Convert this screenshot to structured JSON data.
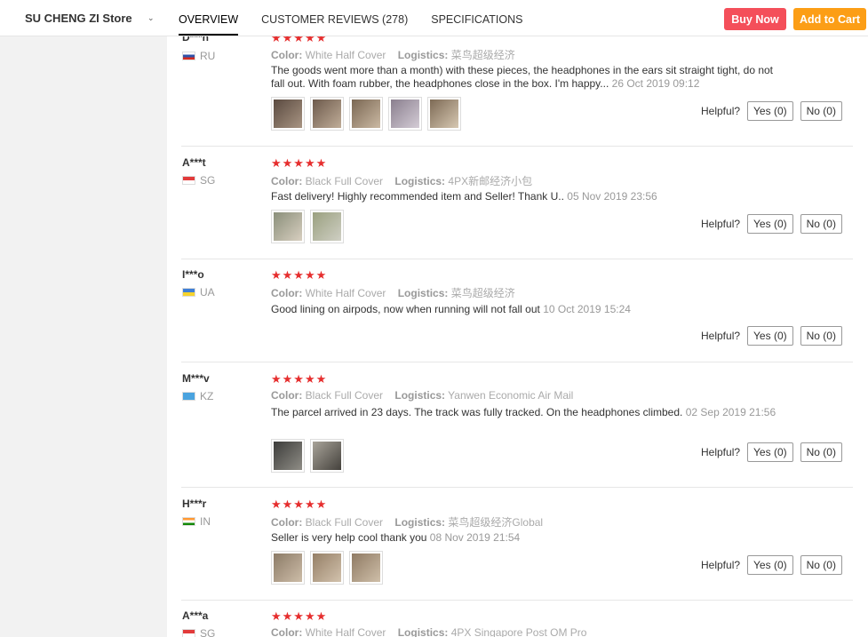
{
  "store": {
    "name": "SU CHENG ZI Store",
    "caret": "⌄"
  },
  "tabs": [
    {
      "label": "OVERVIEW"
    },
    {
      "label": "CUSTOMER REVIEWS (278)"
    },
    {
      "label": "SPECIFICATIONS"
    }
  ],
  "actions": {
    "buy_now": "Buy Now",
    "add_to_cart": "Add to Cart"
  },
  "labels": {
    "color": "Color:",
    "logistics": "Logistics:",
    "helpful": "Helpful?",
    "stars": "★★★★★"
  },
  "reviews": [
    {
      "user": "D***n",
      "country": "RU",
      "color": "White Half Cover",
      "logistics": "菜鸟超级经济",
      "text": "The goods went more than a month) with these pieces, the headphones in the ears sit straight tight, do not fall out. With foam rubber, the headphones close in the box. I'm happy...",
      "date": "26 Oct 2019 09:12",
      "yes": "Yes (0)",
      "no": "No (0)"
    },
    {
      "user": "A***t",
      "country": "SG",
      "color": "Black Full Cover",
      "logistics": "4PX新邮经济小包",
      "text": "Fast delivery! Highly recommended item and Seller! Thank U..",
      "date": "05 Nov 2019 23:56",
      "yes": "Yes (0)",
      "no": "No (0)"
    },
    {
      "user": "I***o",
      "country": "UA",
      "color": "White Half Cover",
      "logistics": "菜鸟超级经济",
      "text": "Good lining on airpods, now when running will not fall out",
      "date": "10 Oct 2019 15:24",
      "yes": "Yes (0)",
      "no": "No (0)"
    },
    {
      "user": "M***v",
      "country": "KZ",
      "color": "Black Full Cover",
      "logistics": "Yanwen Economic Air Mail",
      "text": "The parcel arrived in 23 days. The track was fully tracked. On the headphones climbed.",
      "date": "02 Sep 2019 21:56",
      "yes": "Yes (0)",
      "no": "No (0)"
    },
    {
      "user": "H***r",
      "country": "IN",
      "color": "Black Full Cover",
      "logistics": "菜鸟超级经济Global",
      "text": "Seller is very help cool thank you",
      "date": "08 Nov 2019 21:54",
      "yes": "Yes (0)",
      "no": "No (0)"
    },
    {
      "user": "A***a",
      "country": "SG",
      "color": "White Half Cover",
      "logistics": "4PX Singapore Post OM Pro",
      "text": "",
      "date": "",
      "yes": "",
      "no": ""
    }
  ],
  "colors": {
    "buy_now": "#f44f5a",
    "add_to_cart": "#fc9e16",
    "stars": "#e62e2e"
  }
}
